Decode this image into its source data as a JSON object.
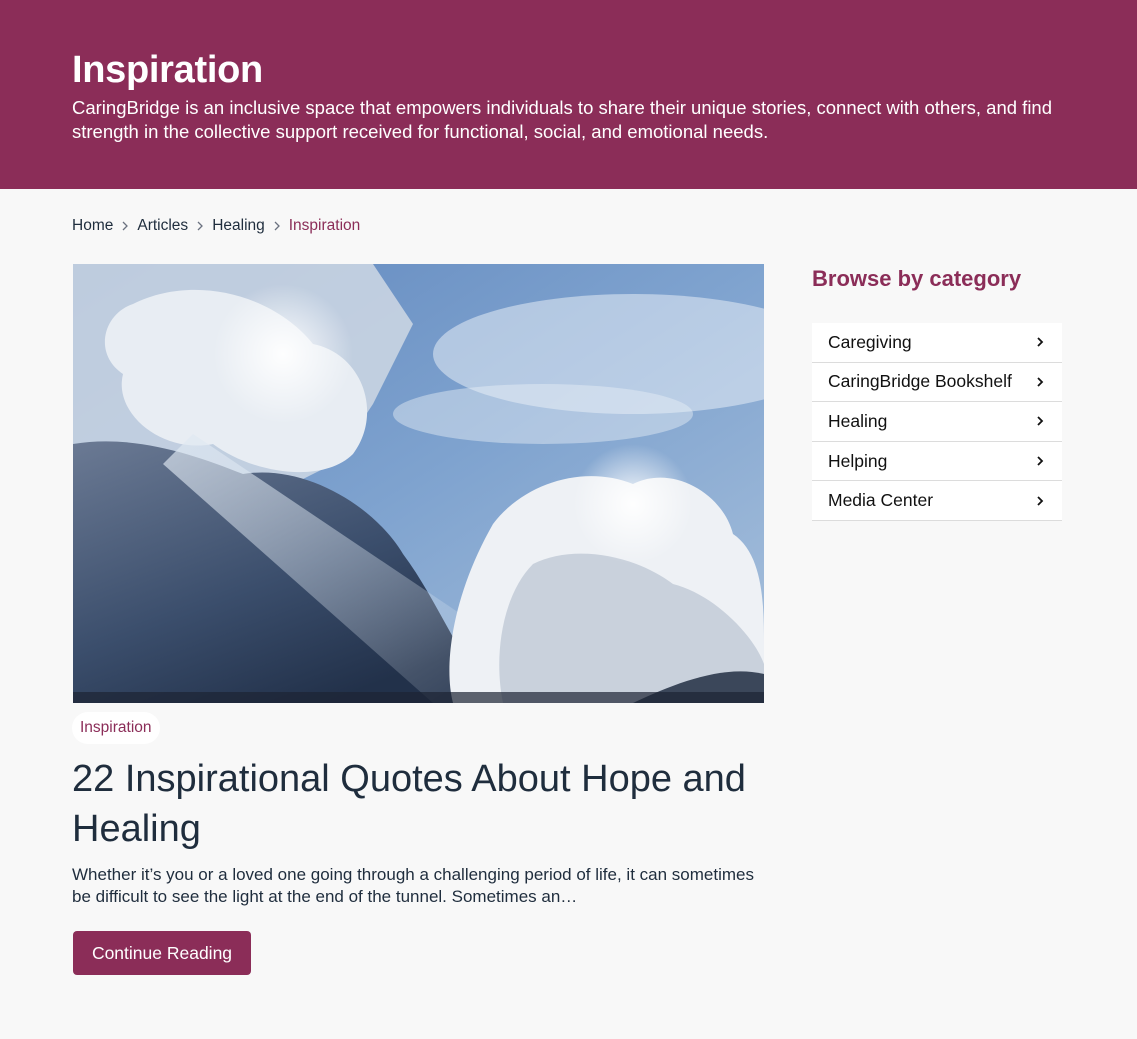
{
  "header": {
    "title": "Inspiration",
    "description": "CaringBridge is an inclusive space that empowers individuals to share their unique stories, connect with others, and find strength in the collective support received for functional, social, and emotional needs."
  },
  "breadcrumb": {
    "items": [
      "Home",
      "Articles",
      "Healing",
      "Inspiration"
    ]
  },
  "article": {
    "image_subject": "sky with sunlit clouds",
    "tag": "Inspiration",
    "title": "22 Inspirational Quotes About Hope and Healing",
    "excerpt": "Whether it’s you or a loved one going through a challenging period of life, it can sometimes be difficult to see the light at the end of the tunnel. Sometimes an…",
    "button_label": "Continue Reading"
  },
  "sidebar": {
    "title": "Browse by category",
    "items": [
      {
        "label": "Caregiving"
      },
      {
        "label": "CaringBridge Bookshelf"
      },
      {
        "label": "Healing"
      },
      {
        "label": "Helping"
      },
      {
        "label": "Media Center"
      }
    ]
  },
  "colors": {
    "brand": "#8b2d58",
    "text": "#1f2d3d",
    "background": "#f8f8f8"
  },
  "icons": {
    "breadcrumb_separator": "chevron-right-icon",
    "category_chevron": "chevron-right-icon"
  }
}
